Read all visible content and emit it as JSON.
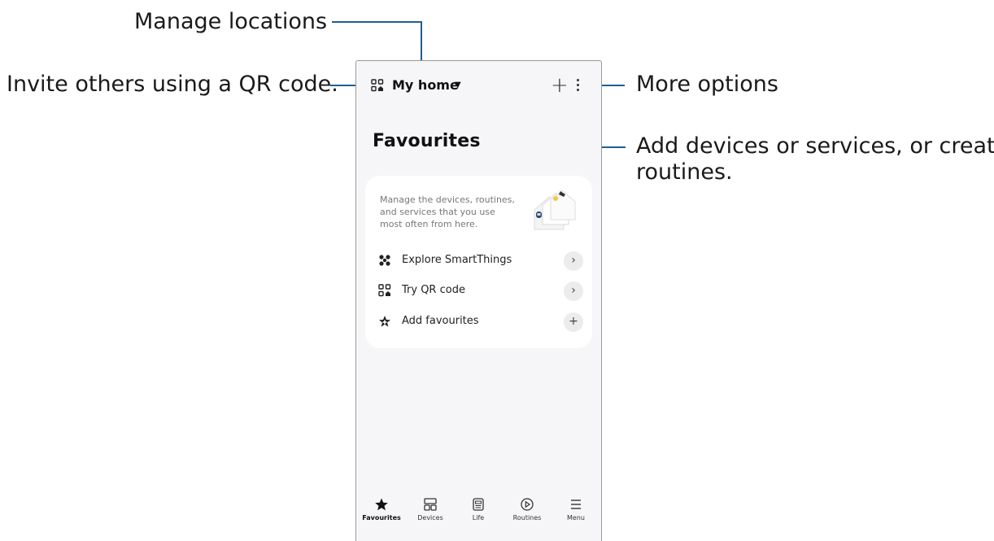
{
  "callouts": {
    "manage_locations": "Manage locations",
    "invite_qr": "Invite others using a QR code.",
    "more_options": "More options",
    "add_devices_line1": "Add devices or services, or create",
    "add_devices_line2": "routines."
  },
  "header": {
    "location_name": "My home",
    "location_icon": "qr-home-icon",
    "add_icon": "plus-icon",
    "more_icon": "more-vertical-icon"
  },
  "page": {
    "title": "Favourites"
  },
  "card": {
    "description": "Manage the devices, routines, and services that you use most often from here.",
    "items": [
      {
        "label": "Explore SmartThings",
        "icon": "smartthings-icon",
        "action_icon": "chevron-right-icon"
      },
      {
        "label": "Try QR code",
        "icon": "qr-home-icon",
        "action_icon": "chevron-right-icon"
      },
      {
        "label": "Add favourites",
        "icon": "star-add-icon",
        "action_icon": "plus-icon"
      }
    ]
  },
  "nav": {
    "items": [
      {
        "label": "Favourites",
        "icon": "star-icon",
        "active": true
      },
      {
        "label": "Devices",
        "icon": "devices-icon",
        "active": false
      },
      {
        "label": "Life",
        "icon": "life-icon",
        "active": false
      },
      {
        "label": "Routines",
        "icon": "routines-icon",
        "active": false
      },
      {
        "label": "Menu",
        "icon": "menu-icon",
        "active": false
      }
    ]
  },
  "colors": {
    "callout_line": "#1f5f8f",
    "phone_bg": "#f6f6f8",
    "card_bg": "#ffffff"
  }
}
